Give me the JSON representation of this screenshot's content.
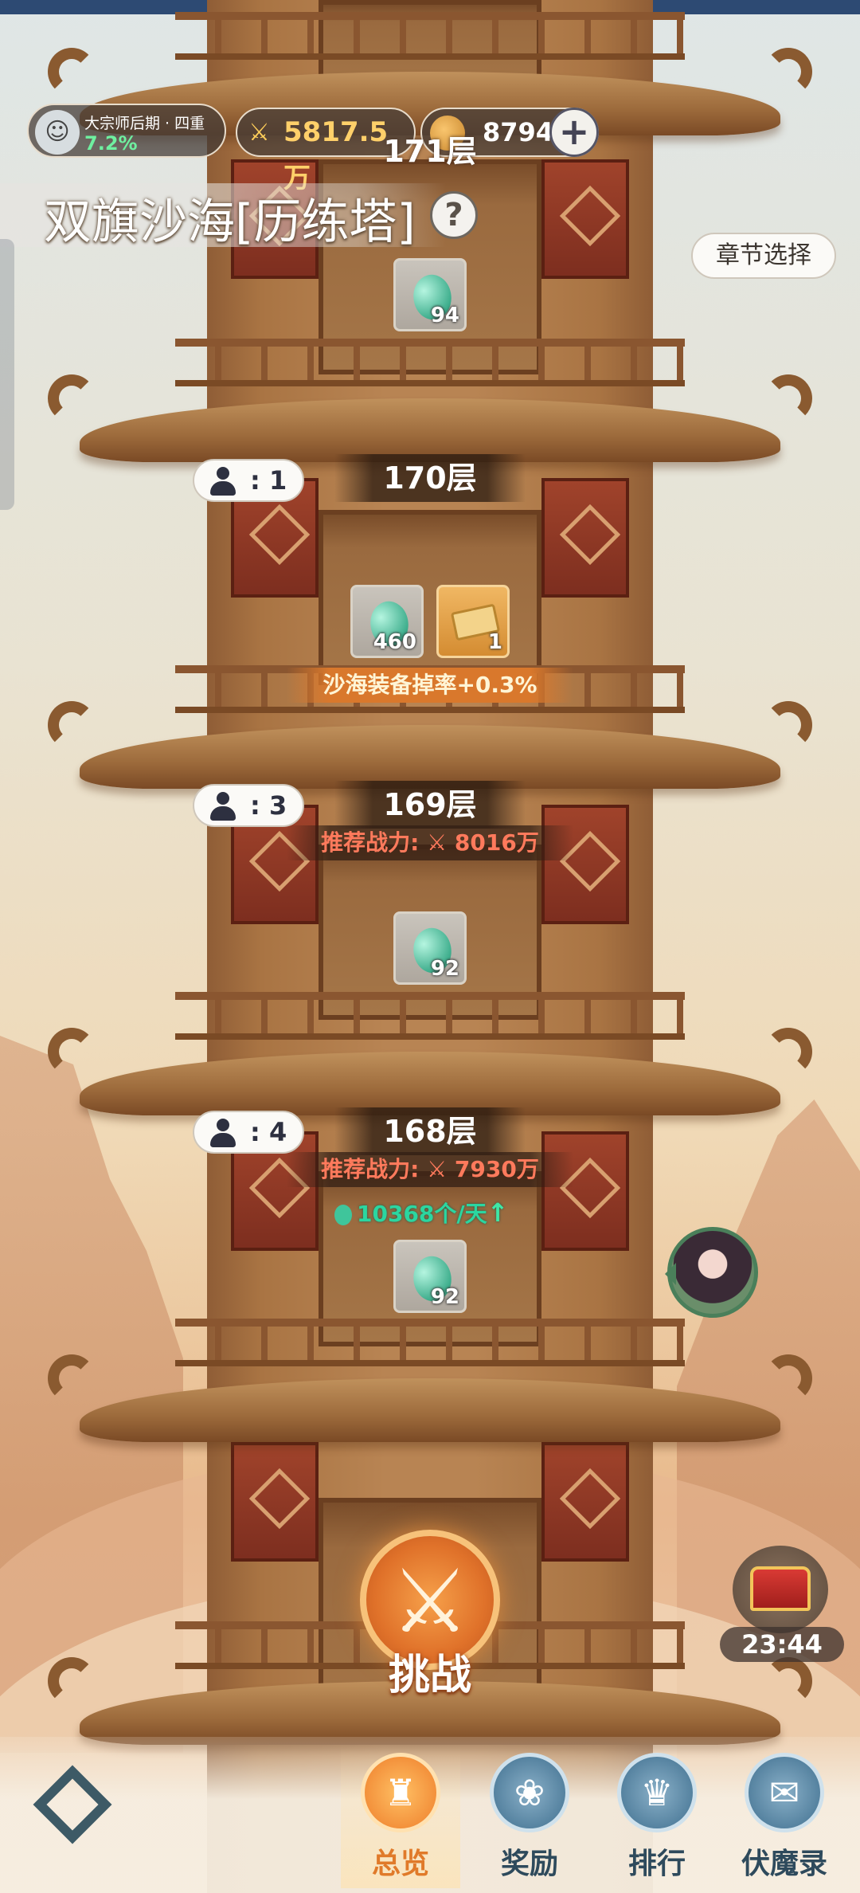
{
  "header": {
    "rank": "大宗师后期 · 四重",
    "rank_progress": "7.2%",
    "power": "5817.5万",
    "jade": "8794"
  },
  "page": {
    "title": "双旗沙海[历练塔]",
    "help": "?",
    "chapter_select": "章节选择"
  },
  "floors": [
    {
      "name": "171层",
      "items": [
        {
          "type": "jade",
          "count": "94"
        }
      ]
    },
    {
      "name": "170层",
      "players": "1",
      "items": [
        {
          "type": "jade",
          "count": "460"
        },
        {
          "type": "scroll",
          "count": "1"
        }
      ],
      "bonus": "沙海装备掉率+0.3%"
    },
    {
      "name": "169层",
      "players": "3",
      "recommend": "推荐战力: ⚔ 8016万",
      "items": [
        {
          "type": "jade",
          "count": "92"
        }
      ]
    },
    {
      "name": "168层",
      "players": "4",
      "recommend": "推荐战力: ⚔ 7930万",
      "yield": "10368个/天",
      "items": [
        {
          "type": "jade",
          "count": "92"
        }
      ]
    }
  ],
  "challenge": {
    "label": "挑战"
  },
  "chest": {
    "timer": "23:44"
  },
  "nav": {
    "items": [
      {
        "label": "总览",
        "icon": "pagoda-icon",
        "active": true
      },
      {
        "label": "奖励",
        "icon": "reward-icon"
      },
      {
        "label": "排行",
        "icon": "ranking-icon"
      },
      {
        "label": "伏魔录",
        "icon": "scroll-icon"
      }
    ]
  },
  "colors": {
    "accent": "#e07a2a",
    "recommend": "#ff7a5c",
    "yield": "#2bd6a0"
  }
}
